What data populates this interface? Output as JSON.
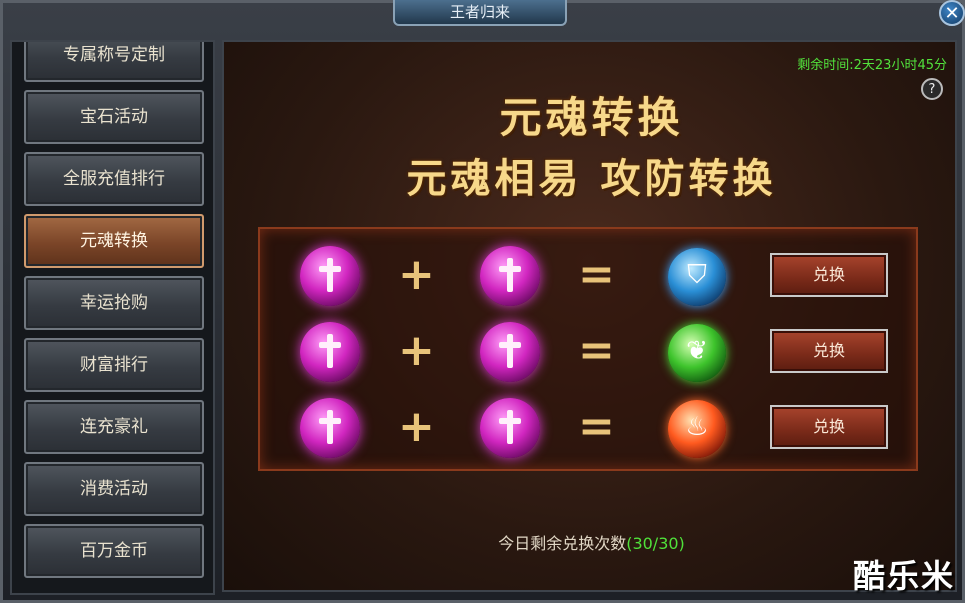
{
  "window": {
    "title": "王者归来"
  },
  "sidebar": {
    "items": [
      {
        "label": "专属称号定制"
      },
      {
        "label": "宝石活动"
      },
      {
        "label": "全服充值排行"
      },
      {
        "label": "元魂转换",
        "active": true
      },
      {
        "label": "幸运抢购"
      },
      {
        "label": "财富排行"
      },
      {
        "label": "连充豪礼"
      },
      {
        "label": "消费活动"
      },
      {
        "label": "百万金币"
      }
    ]
  },
  "main": {
    "timer": "剩余时间:2天23小时45分",
    "help": "?",
    "headline1": "元魂转换",
    "headline2": "元魂相易 攻防转换",
    "rows": [
      {
        "plus": "+",
        "equals": "=",
        "result_icon": "blue-shield-soul-icon",
        "button": "兑换"
      },
      {
        "plus": "+",
        "equals": "=",
        "result_icon": "green-leaf-soul-icon",
        "button": "兑换"
      },
      {
        "plus": "+",
        "equals": "=",
        "result_icon": "red-fire-soul-icon",
        "button": "兑换"
      }
    ],
    "remaining_label": "今日剩余兑换次数",
    "remaining_count": "(30/30)"
  },
  "watermark": "酷乐米",
  "colors": {
    "timer": "#52e23c",
    "headline": "#f7d88a",
    "active_tab": "#7b4528"
  }
}
